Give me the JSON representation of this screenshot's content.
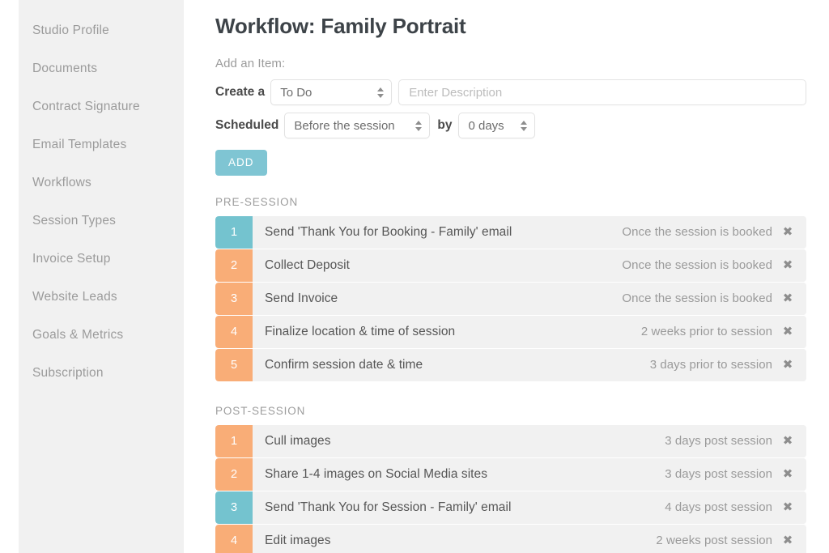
{
  "sidebar": {
    "items": [
      {
        "label": "Studio Profile"
      },
      {
        "label": "Documents"
      },
      {
        "label": "Contract Signature"
      },
      {
        "label": "Email Templates"
      },
      {
        "label": "Workflows"
      },
      {
        "label": "Session Types"
      },
      {
        "label": "Invoice Setup"
      },
      {
        "label": "Website Leads"
      },
      {
        "label": "Goals & Metrics"
      },
      {
        "label": "Subscription"
      }
    ]
  },
  "main": {
    "title": "Workflow: Family Portrait",
    "add_item_label": "Add an Item:",
    "form": {
      "create_a_label": "Create a",
      "item_type_value": "To Do",
      "description_placeholder": "Enter Description",
      "description_value": "",
      "scheduled_label": "Scheduled",
      "when_value": "Before the session",
      "by_label": "by",
      "days_value": "0 days",
      "add_button_label": "ADD"
    },
    "sections": [
      {
        "heading": "PRE-SESSION",
        "rows": [
          {
            "num": "1",
            "color": "teal",
            "title": "Send 'Thank You for Booking - Family' email",
            "when": "Once the session is booked",
            "remove": "✖"
          },
          {
            "num": "2",
            "color": "orange",
            "title": "Collect Deposit",
            "when": "Once the session is booked",
            "remove": "✖"
          },
          {
            "num": "3",
            "color": "orange",
            "title": "Send Invoice",
            "when": "Once the session is booked",
            "remove": "✖"
          },
          {
            "num": "4",
            "color": "orange",
            "title": "Finalize location & time of session",
            "when": "2 weeks prior to session",
            "remove": "✖"
          },
          {
            "num": "5",
            "color": "orange",
            "title": "Confirm session date & time",
            "when": "3 days prior to session",
            "remove": "✖"
          }
        ]
      },
      {
        "heading": "POST-SESSION",
        "rows": [
          {
            "num": "1",
            "color": "orange",
            "title": "Cull images",
            "when": "3 days post session",
            "remove": "✖"
          },
          {
            "num": "2",
            "color": "orange",
            "title": "Share 1-4 images on Social Media sites",
            "when": "3 days post session",
            "remove": "✖"
          },
          {
            "num": "3",
            "color": "teal",
            "title": "Send 'Thank You for Session - Family' email",
            "when": "4 days post session",
            "remove": "✖"
          },
          {
            "num": "4",
            "color": "orange",
            "title": "Edit images",
            "when": "2 weeks post session",
            "remove": "✖"
          }
        ]
      }
    ]
  },
  "colors": {
    "teal": "#74c3cf",
    "orange": "#f9ad77",
    "add_button": "#7fc5d3",
    "sidebar_bg": "#f1f1f1",
    "row_bg": "#f1f1f1"
  }
}
